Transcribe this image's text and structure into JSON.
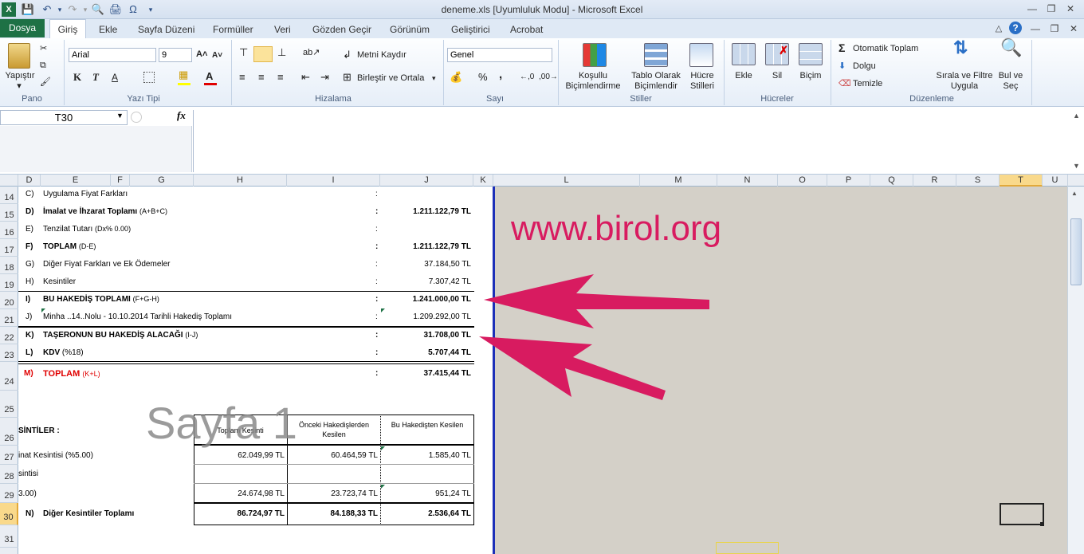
{
  "window": {
    "title": "deneme.xls  [Uyumluluk Modu]  -  Microsoft Excel"
  },
  "tabs": [
    "Dosya",
    "Giriş",
    "Ekle",
    "Sayfa Düzeni",
    "Formüller",
    "Veri",
    "Gözden Geçir",
    "Görünüm",
    "Geliştirici",
    "Acrobat"
  ],
  "ribbon": {
    "pano": {
      "label": "Pano",
      "paste": "Yapıştır"
    },
    "font": {
      "label": "Yazı Tipi",
      "name": "Arial",
      "size": "9",
      "bold": "K",
      "italic": "T",
      "underline": "A"
    },
    "align": {
      "label": "Hizalama",
      "wrap": "Metni Kaydır",
      "merge": "Birleştir ve Ortala"
    },
    "number": {
      "label": "Sayı",
      "format": "Genel",
      "percent": "%",
      "comma": ","
    },
    "styles": {
      "label": "Stiller",
      "cond": "Koşullu Biçimlendirme",
      "table": "Tablo Olarak Biçimlendir",
      "cell": "Hücre Stilleri"
    },
    "cells": {
      "label": "Hücreler",
      "insert": "Ekle",
      "delete": "Sil",
      "format": "Biçim"
    },
    "edit": {
      "label": "Düzenleme",
      "autosum": "Otomatik Toplam",
      "fill": "Dolgu",
      "clear": "Temizle",
      "sort": "Sırala ve Filtre Uygula",
      "find": "Bul ve Seç"
    }
  },
  "formula_bar": {
    "name_box": "T30",
    "fx": "fx",
    "formula": ""
  },
  "columns": [
    "D",
    "E",
    "F",
    "G",
    "H",
    "I",
    "J",
    "K",
    "L",
    "M",
    "N",
    "O",
    "P",
    "Q",
    "R",
    "S",
    "T",
    "U"
  ],
  "rows": [
    "14",
    "15",
    "16",
    "17",
    "18",
    "19",
    "20",
    "21",
    "22",
    "23",
    "24",
    "25",
    "26",
    "27",
    "28",
    "29",
    "30",
    "31"
  ],
  "sheet": {
    "r14": {
      "code": "C)",
      "label": "Uygulama Fiyat Farkları",
      "colon": ":",
      "value": ""
    },
    "r15": {
      "code": "D)",
      "label": "İmalat ve İhzarat Toplamı",
      "sub": "(A+B+C)",
      "colon": ":",
      "value": "1.211.122,79 TL"
    },
    "r16": {
      "code": "E)",
      "label": "Tenzilat Tutarı",
      "sub": "(Dx% 0.00)",
      "colon": ":",
      "value": ""
    },
    "r17": {
      "code": "F)",
      "label": "TOPLAM",
      "sub": "(D-E)",
      "colon": ":",
      "value": "1.211.122,79 TL"
    },
    "r18": {
      "code": "G)",
      "label": "Diğer Fiyat Farkları ve Ek Ödemeler",
      "colon": ":",
      "value": "37.184,50 TL"
    },
    "r19": {
      "code": "H)",
      "label": "Kesintiler",
      "colon": ":",
      "value": "7.307,42 TL"
    },
    "r20": {
      "code": "I)",
      "label": "BU HAKEDİŞ TOPLAMI",
      "sub": "(F+G-H)",
      "colon": ":",
      "value": "1.241.000,00 TL"
    },
    "r21": {
      "code": "J)",
      "label": "Minha ..14..Nolu - 10.10.2014  Tarihli Hakediş Toplamı",
      "colon": ":",
      "value": "1.209.292,00 TL"
    },
    "r22": {
      "code": "K)",
      "label": "TAŞERONUN BU HAKEDİŞ ALACAĞI",
      "sub": "(I-J)",
      "colon": ":",
      "value": "31.708,00 TL"
    },
    "r23": {
      "code": "L)",
      "label": "KDV",
      "sub": "(%18)",
      "colon": ":",
      "value": "5.707,44 TL"
    },
    "r24": {
      "code": "M)",
      "label": "TOPLAM",
      "sub": "(K+L)",
      "colon": ":",
      "value": "37.415,44 TL"
    },
    "table_header": {
      "title": "SİNTİLER :",
      "h1": "Toplam Kesinti",
      "h2": "Önceki Hakedişlerden Kesilen",
      "h3": "Bu Hakedişten Kesilen"
    },
    "r27": {
      "label": "inat Kesintisi (%5.00)",
      "v1": "62.049,99 TL",
      "v2": "60.464,59 TL",
      "v3": "1.585,40 TL"
    },
    "r28": {
      "label": "sintisi",
      "v1": "",
      "v2": "",
      "v3": ""
    },
    "r29": {
      "label": "3.00)",
      "v1": "24.674,98 TL",
      "v2": "23.723,74 TL",
      "v3": "951,24 TL"
    },
    "r30": {
      "code": "N)",
      "label": "Diğer Kesintiler Toplamı",
      "v1": "86.724,97 TL",
      "v2": "84.188,33 TL",
      "v3": "2.536,64 TL"
    }
  },
  "watermark": {
    "page": "Sayfa 1",
    "site": "www.birol.org"
  },
  "colors": {
    "accent": "#d81b60",
    "excel_green": "#1e7145",
    "page_break": "#1c2fb8"
  }
}
